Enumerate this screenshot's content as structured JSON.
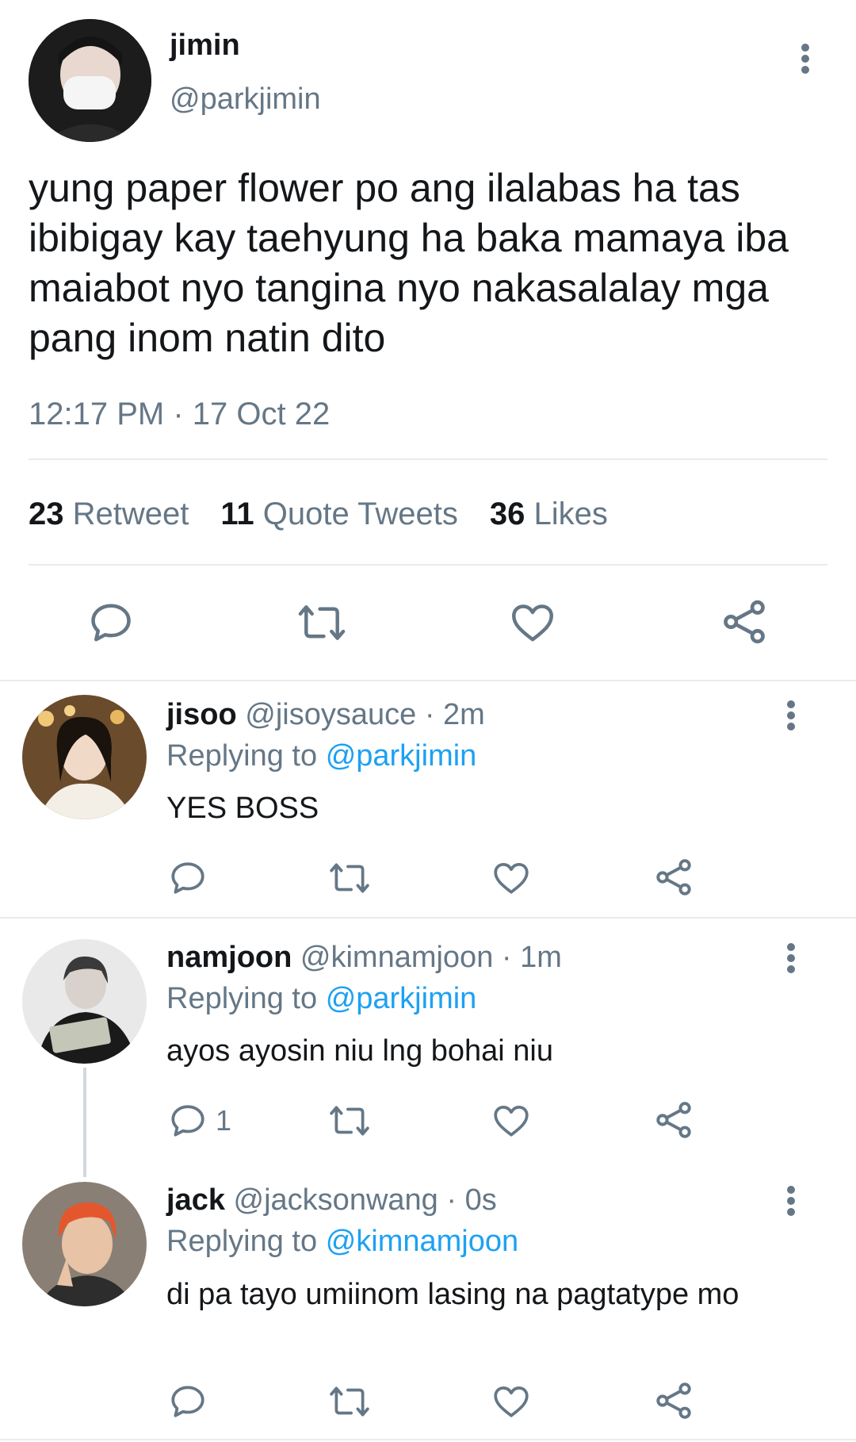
{
  "colors": {
    "accent": "#1da1f2",
    "muted": "#657786",
    "text": "#14171a",
    "divider": "#e6ecf0"
  },
  "main_tweet": {
    "name": "jimin",
    "handle": "@parkjimin",
    "text": "yung paper flower po ang ilalabas ha tas ibibigay kay taehyung ha baka mamaya iba maiabot nyo tangina nyo nakasalalay mga pang inom natin dito",
    "timestamp": "12:17 PM · 17 Oct 22",
    "stats": {
      "retweet_count": "23",
      "retweet_label": "Retweet",
      "quote_count": "11",
      "quote_label": "Quote Tweets",
      "likes_count": "36",
      "likes_label": "Likes"
    }
  },
  "replies": [
    {
      "name": "jisoo",
      "handle": "@jisoysauce",
      "time": "· 2m",
      "replying_label": "Replying to",
      "replying_to": "@parkjimin",
      "text": "YES BOSS",
      "reply_count": ""
    },
    {
      "name": "namjoon",
      "handle": "@kimnamjoon",
      "time": "· 1m",
      "replying_label": "Replying to",
      "replying_to": "@parkjimin",
      "text": "ayos ayosin niu lng bohai niu",
      "reply_count": "1"
    },
    {
      "name": "jack",
      "handle": "@jacksonwang",
      "time": "· 0s",
      "replying_label": "Replying to",
      "replying_to": "@kimnamjoon",
      "text": "di pa tayo umiinom lasing na pagtatype mo",
      "reply_count": ""
    }
  ],
  "icons": [
    "more-vertical-icon",
    "reply-icon",
    "retweet-icon",
    "like-icon",
    "share-icon"
  ]
}
